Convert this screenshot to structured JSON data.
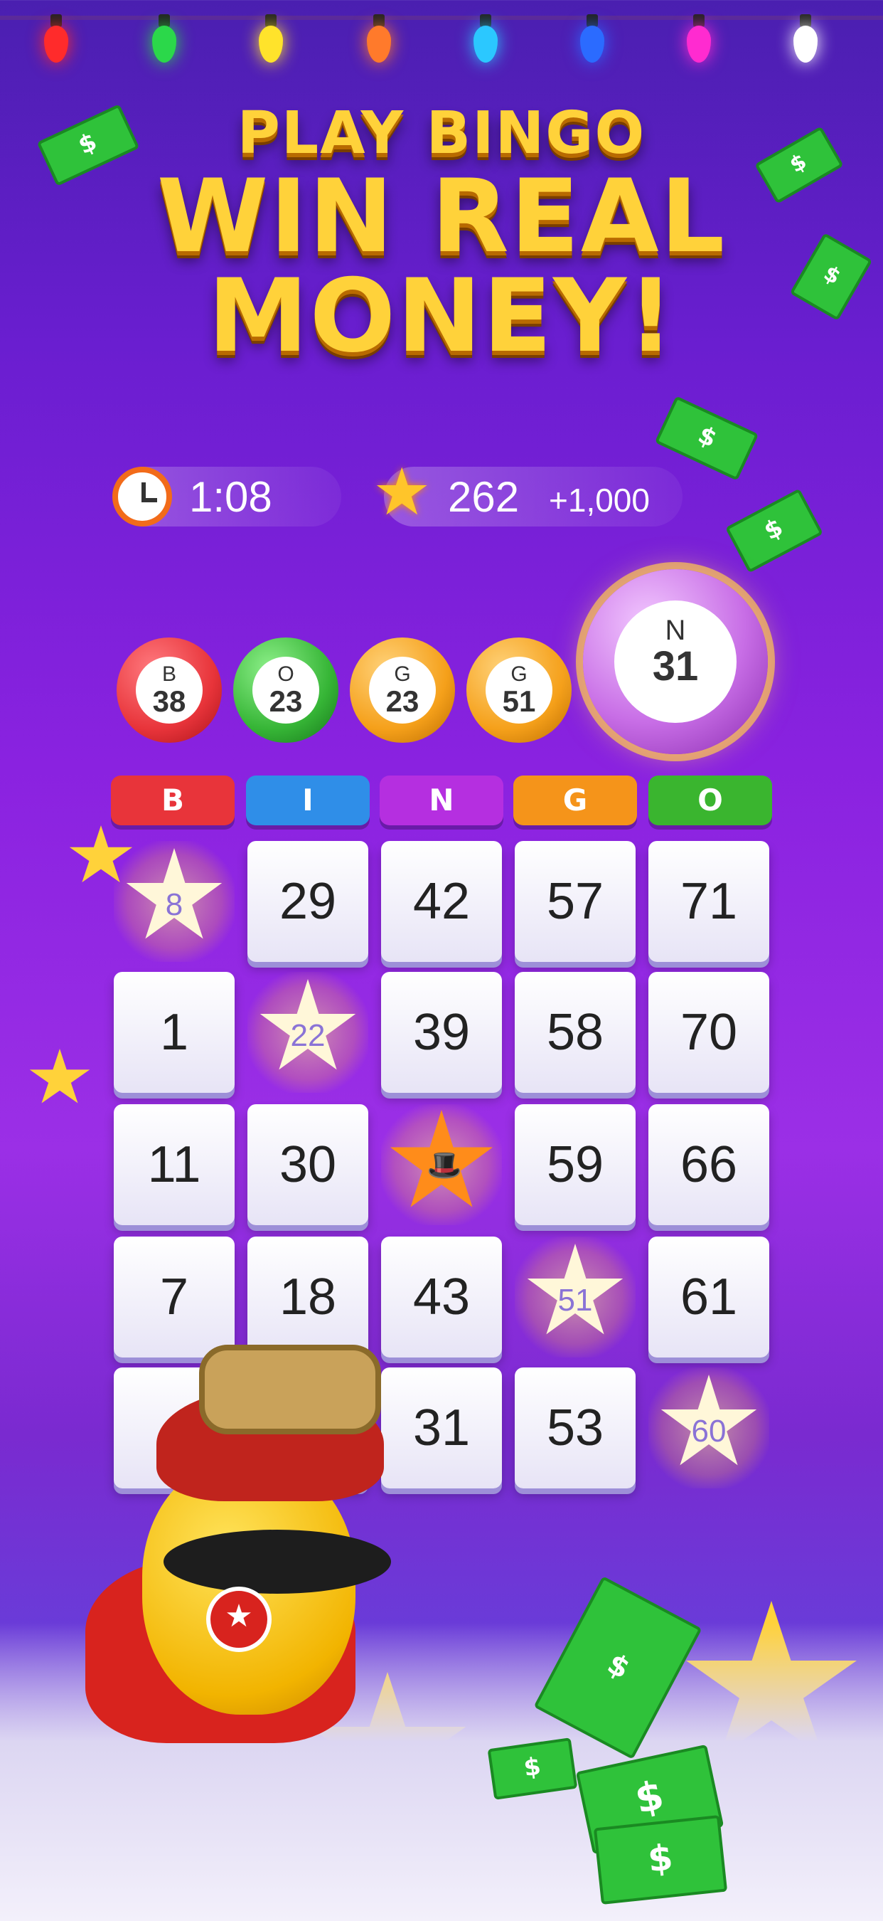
{
  "title": {
    "line1": "PLAY BINGO",
    "line2": "WIN REAL",
    "line3": "MONEY!"
  },
  "stats": {
    "timer": "1:08",
    "score": "262",
    "bonus": "+1,000"
  },
  "called_balls": [
    {
      "letter": "B",
      "number": "38",
      "color": "#e8343a"
    },
    {
      "letter": "O",
      "number": "23",
      "color": "#36b536"
    },
    {
      "letter": "G",
      "number": "23",
      "color": "#f5a01a"
    },
    {
      "letter": "G",
      "number": "51",
      "color": "#f5a01a"
    }
  ],
  "current_ball": {
    "letter": "N",
    "number": "31",
    "color": "#c86ee6"
  },
  "headers": [
    {
      "label": "B",
      "color": "#e8343a"
    },
    {
      "label": "I",
      "color": "#2f8ee8"
    },
    {
      "label": "N",
      "color": "#b52fe0"
    },
    {
      "label": "G",
      "color": "#f5941a"
    },
    {
      "label": "O",
      "color": "#3ab52f"
    }
  ],
  "grid": [
    [
      {
        "n": "8",
        "marked": true
      },
      {
        "n": "29"
      },
      {
        "n": "42"
      },
      {
        "n": "57"
      },
      {
        "n": "71"
      }
    ],
    [
      {
        "n": "1"
      },
      {
        "n": "22",
        "marked": true
      },
      {
        "n": "39"
      },
      {
        "n": "58"
      },
      {
        "n": "70"
      }
    ],
    [
      {
        "n": "11"
      },
      {
        "n": "30"
      },
      {
        "n": "",
        "free": true
      },
      {
        "n": "59"
      },
      {
        "n": "66"
      }
    ],
    [
      {
        "n": "7"
      },
      {
        "n": "18"
      },
      {
        "n": "43"
      },
      {
        "n": "51",
        "marked": true
      },
      {
        "n": "61"
      }
    ],
    [
      {
        "n": ""
      },
      {
        "n": ""
      },
      {
        "n": "31"
      },
      {
        "n": "53"
      },
      {
        "n": "60",
        "marked": true
      }
    ]
  ],
  "bill_symbol": "$"
}
